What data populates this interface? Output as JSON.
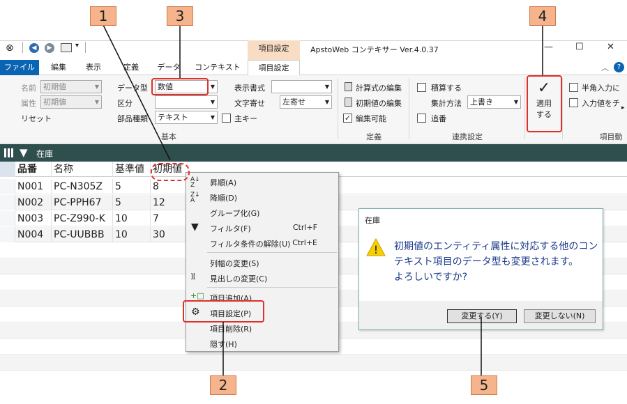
{
  "window": {
    "title": "ApstoWeb コンテキサー Ver.4.0.37",
    "context_tab_header": "項目設定",
    "controls": {
      "minimize": "—",
      "maximize": "☐",
      "close": "✕"
    }
  },
  "tabs": [
    {
      "label": "ファイル"
    },
    {
      "label": "編集"
    },
    {
      "label": "表示"
    },
    {
      "label": "定義"
    },
    {
      "label": "データ"
    },
    {
      "label": "コンテキスト"
    },
    {
      "label": "項目設定"
    }
  ],
  "ribbon": {
    "name_label": "名前",
    "name_value": "初期値",
    "attr_label": "属性",
    "attr_value": "初期値",
    "reset_label": "リセット",
    "datatype_label": "データ型",
    "datatype_value": "数値",
    "kubun_label": "区分",
    "kubun_value": "",
    "parttype_label": "部品種類",
    "parttype_value": "テキスト",
    "primarykey_label": "主キー",
    "displayformat_label": "表示書式",
    "displayformat_value": "",
    "textalign_label": "文字寄せ",
    "textalign_value": "左寄せ",
    "formula_edit_label": "計算式の編集",
    "initial_edit_label": "初期値の編集",
    "editable_label": "編集可能",
    "accumulate_label": "積算する",
    "aggregate_label": "集計方法",
    "aggregate_value": "上書き",
    "append_label": "追番",
    "apply_label_1": "適用",
    "apply_label_2": "する",
    "halfwidth_label": "半角入力に",
    "input_check_label": "入力値をチ",
    "group_basic": "基本",
    "group_definition": "定義",
    "group_link": "連携設定",
    "group_item": "項目動"
  },
  "grid": {
    "sheet_title": "在庫",
    "columns": [
      "品番",
      "名称",
      "基準値",
      "初期値"
    ],
    "rows": [
      [
        "N001",
        "PC-N305Z",
        "5",
        "8"
      ],
      [
        "N002",
        "PC-PPH67",
        "5",
        "12"
      ],
      [
        "N003",
        "PC-Z990-K",
        "10",
        "7"
      ],
      [
        "N004",
        "PC-UUBBB",
        "10",
        "30"
      ]
    ]
  },
  "context_menu": {
    "items": [
      {
        "label": "昇順(A)",
        "shortcut": ""
      },
      {
        "label": "降順(D)",
        "shortcut": ""
      },
      {
        "label": "グループ化(G)",
        "shortcut": ""
      },
      {
        "label": "フィルタ(F)",
        "shortcut": "Ctrl+F"
      },
      {
        "label": "フィルタ条件の解除(U)",
        "shortcut": "Ctrl+E"
      },
      {
        "label": "列幅の変更(S)",
        "shortcut": ""
      },
      {
        "label": "見出しの変更(C)",
        "shortcut": ""
      },
      {
        "label": "項目追加(A)",
        "shortcut": ""
      },
      {
        "label": "項目設定(P)",
        "shortcut": ""
      },
      {
        "label": "項目削除(R)",
        "shortcut": ""
      },
      {
        "label": "隠す(H)",
        "shortcut": ""
      }
    ]
  },
  "dialog": {
    "title": "在庫",
    "message_line1": "初期値のエンティティ属性に対応する他のコン",
    "message_line2": "テキスト項目のデータ型も変更されます。",
    "message_line3": "よろしいですか?",
    "yes_button": "変更する(Y)",
    "no_button": "変更しない(N)"
  },
  "callouts": [
    "1",
    "2",
    "3",
    "4",
    "5"
  ],
  "colors": {
    "accent": "#0a64b4",
    "grid_header": "#2f4f4f",
    "callout": "#f5b48c",
    "highlight": "#e0302a"
  }
}
